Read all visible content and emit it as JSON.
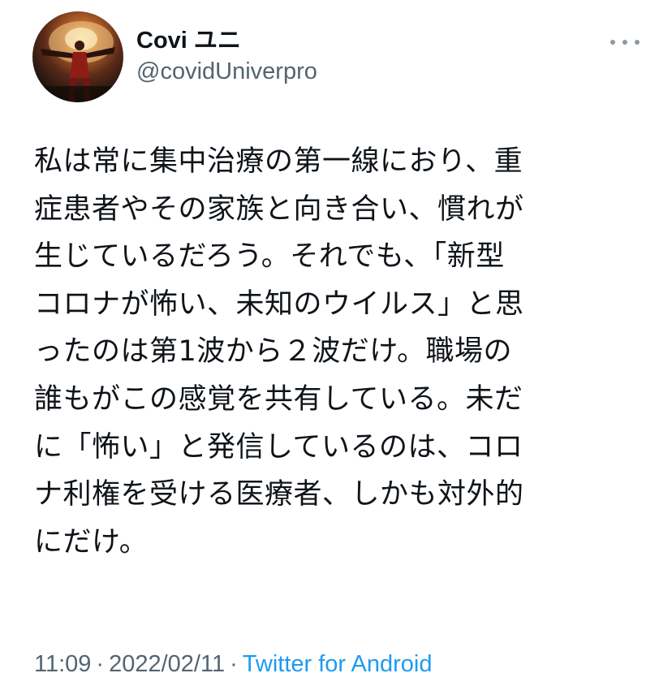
{
  "tweet": {
    "author": {
      "display_name": "Covi ユニ",
      "handle": "@covidUniverpro"
    },
    "more_icon": "more-horizontal-icon",
    "text_lines": [
      "私は常に集中治療の第一線におり、重",
      "症患者やその家族と向き合い、慣れが",
      "生じているだろう。それでも、「新型",
      "コロナが怖い、未知のウイルス」と思",
      "ったのは第1波から２波だけ。職場の",
      "誰もがこの感覚を共有している。未だ",
      "に「怖い」と発信しているのは、コロ",
      "ナ利権を受ける医療者、しかも対外的",
      "にだけ。"
    ],
    "time": "11:09",
    "date": "2022/02/11",
    "separator": "·",
    "source": "Twitter for Android"
  },
  "colors": {
    "text": "#0f1419",
    "secondary": "#536471",
    "link": "#1d9bf0"
  }
}
